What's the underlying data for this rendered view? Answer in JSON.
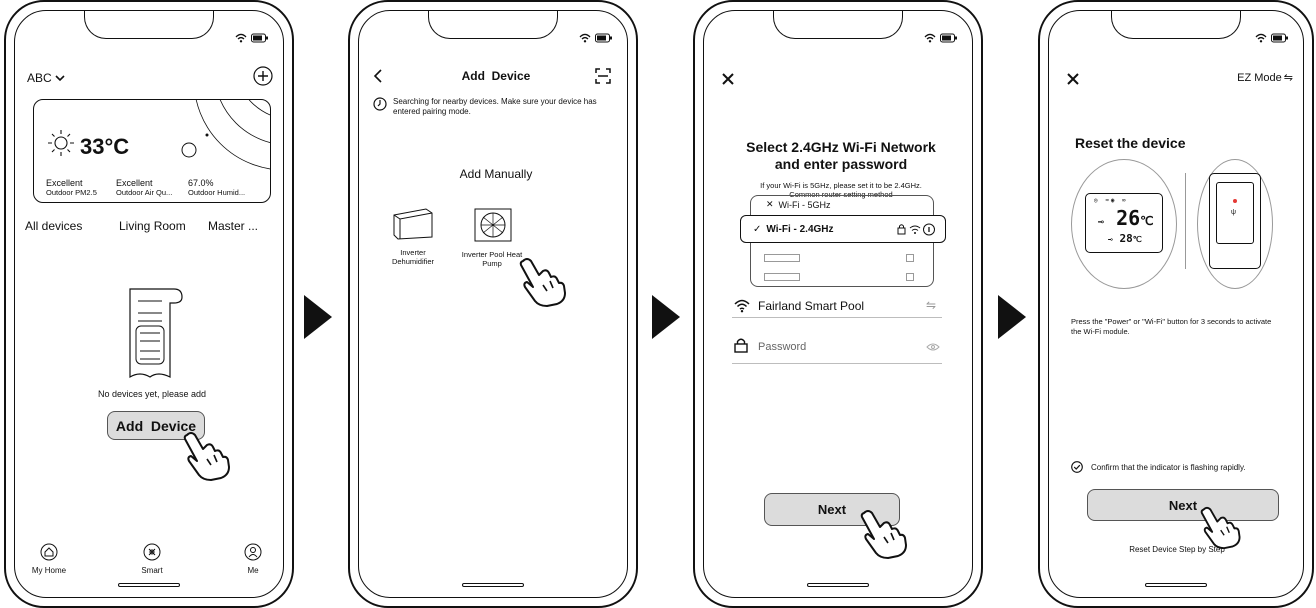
{
  "arrows": [
    "arrow-1",
    "arrow-2",
    "arrow-3"
  ],
  "screen1": {
    "home_name": "ABC",
    "temperature": "33°C",
    "weather": [
      {
        "value": "Excellent",
        "label": "Outdoor PM2.5"
      },
      {
        "value": "Excellent",
        "label": "Outdoor Air Qu..."
      },
      {
        "value": "67.0%",
        "label": "Outdoor Humid..."
      }
    ],
    "tabs": [
      "All devices",
      "Living Room",
      "Master ..."
    ],
    "empty_text": "No devices yet, please add",
    "add_button": "Add  Device",
    "nav": [
      {
        "label": "My Home",
        "icon": "home-icon"
      },
      {
        "label": "Smart",
        "icon": "smart-icon"
      },
      {
        "label": "Me",
        "icon": "me-icon"
      }
    ]
  },
  "screen2": {
    "title": "Add  Device",
    "searching": "Searching for nearby devices. Make sure your device has entered pairing mode.",
    "section": "Add Manually",
    "devices": [
      {
        "name": "Inverter Dehumidifier"
      },
      {
        "name": "Inverter Pool Heat Pump"
      }
    ]
  },
  "screen3": {
    "title": "Select 2.4GHz Wi-Fi Network and enter password",
    "hint": "If your Wi-Fi is 5GHz, please set it to be 2.4GHz. Common router setting method",
    "wifi_5g": "Wi-Fi - 5GHz",
    "wifi_24g": "Wi-Fi - 2.4GHz",
    "network_name": "Fairland Smart Pool",
    "password_placeholder": "Password",
    "next": "Next"
  },
  "screen4": {
    "mode": "EZ Mode",
    "title": "Reset the device",
    "lcd_main": "26",
    "lcd_sub": "28",
    "instruction": "Press the \"Power\" or \"Wi-Fi\" button for 3 seconds to activate the Wi-Fi module.",
    "confirm": "Confirm that the indicator is flashing rapidly.",
    "next": "Next",
    "reset_link": "Reset Device Step by Step"
  }
}
